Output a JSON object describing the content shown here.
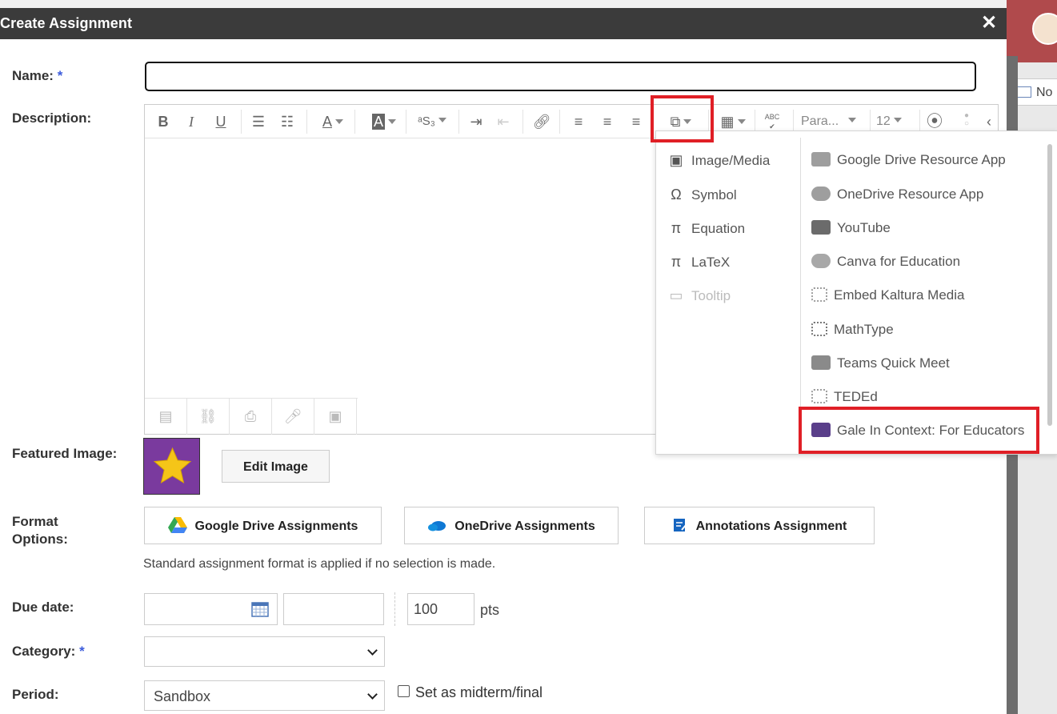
{
  "modal": {
    "title": "Create Assignment",
    "close_glyph": "✕"
  },
  "background": {
    "notification_label": "No"
  },
  "form": {
    "name_label": "Name:",
    "required_mark": "*",
    "description_label": "Description:",
    "featured_image_label": "Featured Image:",
    "edit_image_button": "Edit Image",
    "format_options_label_line1": "Format",
    "format_options_label_line2": "Options:",
    "format_buttons": [
      {
        "label": "Google Drive Assignments",
        "icon": "google-drive-icon"
      },
      {
        "label": "OneDrive Assignments",
        "icon": "onedrive-icon"
      },
      {
        "label": "Annotations Assignment",
        "icon": "annotations-icon"
      }
    ],
    "format_helper": "Standard assignment format is applied if no selection is made.",
    "due_date_label": "Due date:",
    "date_value": "",
    "time_value": "",
    "points_value": "100",
    "points_unit": "pts",
    "category_label": "Category:",
    "category_value": "",
    "period_label": "Period:",
    "period_value": "Sandbox",
    "midterm_label": "Set as midterm/final",
    "midterm_checked": false
  },
  "toolbar": {
    "bold": "B",
    "italic": "I",
    "underline": "U",
    "paragraph_format": "Para...",
    "font_size": "12",
    "spellcheck_label": "ABC"
  },
  "insert_menu": {
    "left_items": [
      {
        "label": "Image/Media",
        "icon": "image-icon",
        "glyph": "▣",
        "disabled": false
      },
      {
        "label": "Symbol",
        "icon": "omega-icon",
        "glyph": "Ω",
        "disabled": false
      },
      {
        "label": "Equation",
        "icon": "pi-icon",
        "glyph": "π",
        "disabled": false
      },
      {
        "label": "LaTeX",
        "icon": "pi-icon",
        "glyph": "π",
        "disabled": false
      },
      {
        "label": "Tooltip",
        "icon": "speech-bubble-icon",
        "glyph": "▭",
        "disabled": true
      }
    ],
    "right_items": [
      {
        "label": "Google Drive Resource App",
        "icon": "google-drive-icon",
        "color": "#9e9e9e"
      },
      {
        "label": "OneDrive Resource App",
        "icon": "onedrive-icon",
        "color": "#9e9e9e"
      },
      {
        "label": "YouTube",
        "icon": "youtube-icon",
        "color": "#6b6b6b"
      },
      {
        "label": "Canva for Education",
        "icon": "canva-icon",
        "color": "#a8a8a8"
      },
      {
        "label": "Embed Kaltura Media",
        "icon": "kaltura-icon",
        "color": "#9e9e9e"
      },
      {
        "label": "MathType",
        "icon": "mathtype-icon",
        "color": "#777777"
      },
      {
        "label": "Teams Quick Meet",
        "icon": "teams-icon",
        "color": "#8a8a8a"
      },
      {
        "label": "TEDEd",
        "icon": "teded-icon",
        "color": "#9e9e9e"
      },
      {
        "label": "Gale In Context: For Educators",
        "icon": "gale-icon",
        "color": "#5a3f8a"
      }
    ]
  },
  "colors": {
    "highlight": "#e01f26",
    "header_bg": "#3b3b3b",
    "required": "#3b5bdb",
    "featured_image_bg": "#7a3a9e",
    "star": "#f5c518"
  }
}
